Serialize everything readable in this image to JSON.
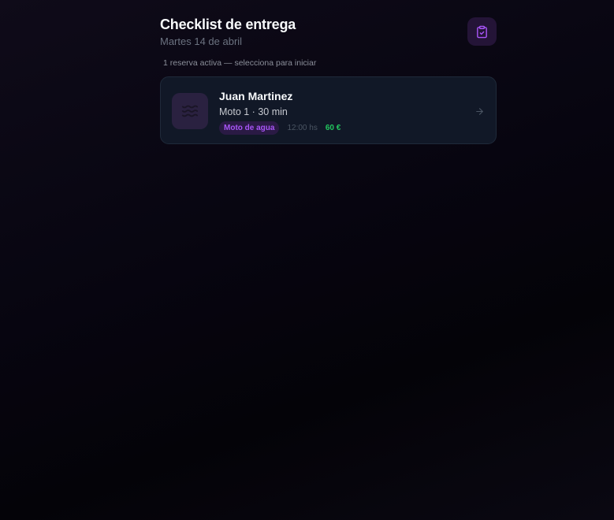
{
  "header": {
    "title": "Checklist de entrega",
    "date": "Martes 14 de abril",
    "action_icon": "clipboard-check-icon"
  },
  "hint": "1 reserva activa — selecciona para iniciar",
  "reservations": [
    {
      "customer": "Juan Martinez",
      "detail": "Moto 1 · 30 min",
      "category": "Moto de agua",
      "time": "12:00 hs",
      "price": "60 €",
      "icon": "waves-icon"
    }
  ],
  "colors": {
    "accent": "#a855f7",
    "price": "#22c55e",
    "card_bg": "#111827"
  }
}
